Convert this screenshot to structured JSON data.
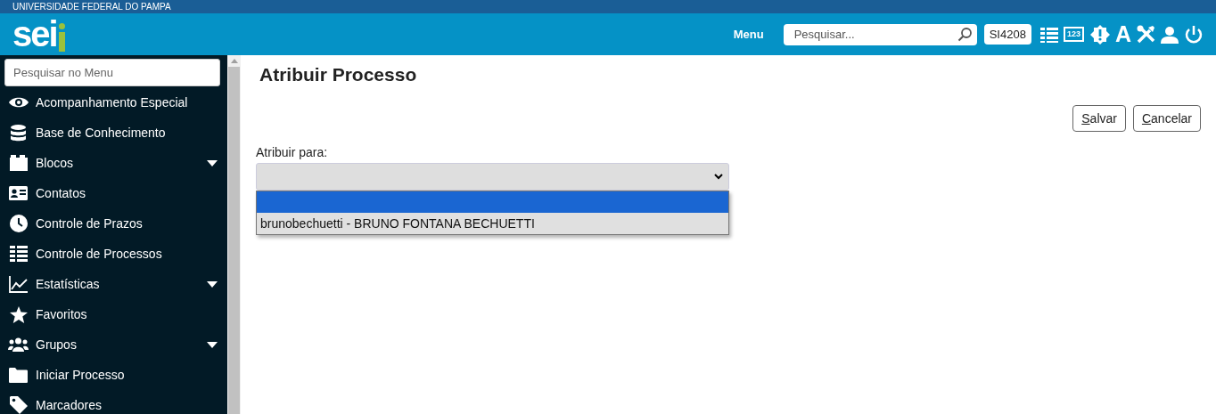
{
  "banner": {
    "title": "UNIVERSIDADE FEDERAL DO PAMPA"
  },
  "header": {
    "logo": "sei",
    "menu_label": "Menu",
    "search": {
      "placeholder": "Pesquisar..."
    },
    "unit": "SI4208",
    "icons": [
      {
        "kind": "list"
      },
      {
        "kind": "numbers",
        "text": "123"
      },
      {
        "kind": "alert"
      },
      {
        "kind": "letter",
        "text": "A"
      },
      {
        "kind": "tools"
      },
      {
        "kind": "user"
      },
      {
        "kind": "power"
      }
    ]
  },
  "sidebar": {
    "search": {
      "placeholder": "Pesquisar no Menu"
    },
    "items": [
      {
        "label": "Acompanhamento Especial",
        "kind": "eye",
        "expandable": false
      },
      {
        "label": "Base de Conhecimento",
        "kind": "database",
        "expandable": false
      },
      {
        "label": "Blocos",
        "kind": "blocks",
        "expandable": true
      },
      {
        "label": "Contatos",
        "kind": "contact",
        "expandable": false
      },
      {
        "label": "Controle de Prazos",
        "kind": "clock",
        "expandable": false
      },
      {
        "label": "Controle de Processos",
        "kind": "list",
        "expandable": false
      },
      {
        "label": "Estatísticas",
        "kind": "chart",
        "expandable": true
      },
      {
        "label": "Favoritos",
        "kind": "star",
        "expandable": false
      },
      {
        "label": "Grupos",
        "kind": "users",
        "expandable": true
      },
      {
        "label": "Iniciar Processo",
        "kind": "folder",
        "expandable": false
      },
      {
        "label": "Marcadores",
        "kind": "tag",
        "expandable": false
      }
    ]
  },
  "page": {
    "title": "Atribuir Processo",
    "buttons": [
      {
        "label": "Salvar",
        "accesskey_underlined": true
      },
      {
        "label": "Cancelar",
        "accesskey_underlined": true
      }
    ],
    "field": {
      "label": "Atribuir para:",
      "expanded": true,
      "options": [
        {
          "selected": true
        },
        {
          "label": "brunobechuetti - BRUNO FONTANA BECHUETTI",
          "selected": false
        }
      ]
    }
  }
}
